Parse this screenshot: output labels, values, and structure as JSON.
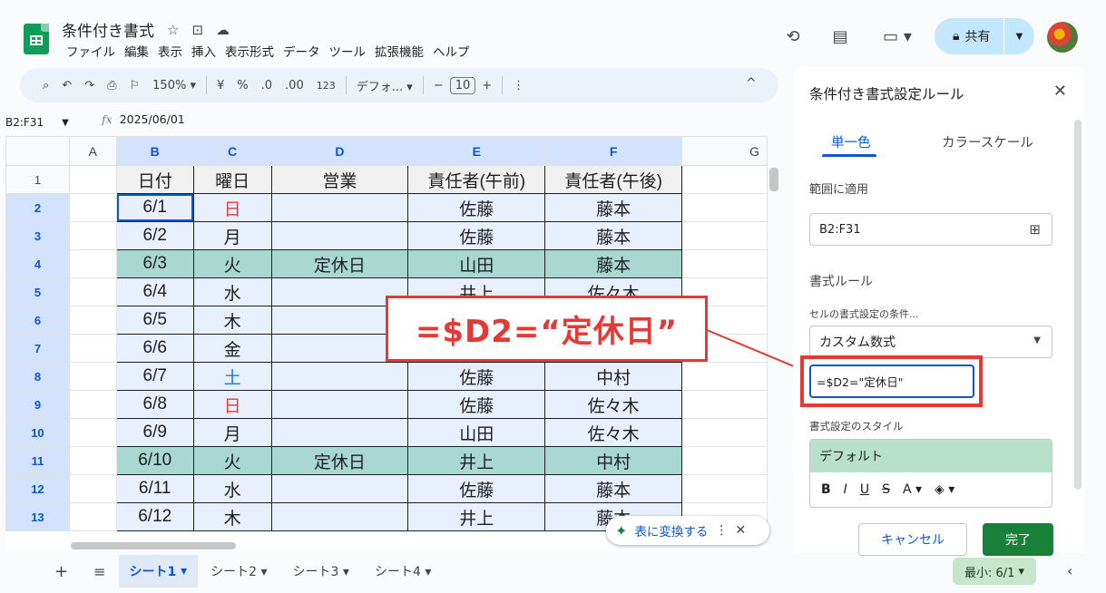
{
  "doc": {
    "title": "条件付き書式",
    "title_icons": [
      "☆",
      "⊡",
      "☁"
    ]
  },
  "menu": [
    "ファイル",
    "編集",
    "表示",
    "挿入",
    "表示形式",
    "データ",
    "ツール",
    "拡張機能",
    "ヘルプ"
  ],
  "header": {
    "share_label": "共有"
  },
  "toolbar": {
    "zoom": "150%",
    "currency": "¥",
    "percent": "%",
    "dec_dec": ".0",
    "dec_inc": ".00",
    "num": "123",
    "font": "デフォ...",
    "minus": "−",
    "font_size": "10",
    "plus": "+",
    "more": "⋮"
  },
  "namebox": "B2:F31",
  "formula": "2025/06/01",
  "columns": [
    "A",
    "B",
    "C",
    "D",
    "E",
    "F",
    "G"
  ],
  "header_row": [
    "日付",
    "曜日",
    "営業",
    "責任者(午前)",
    "責任者(午後)"
  ],
  "rows": [
    {
      "n": "2",
      "date": "6/1",
      "day": "日",
      "business": "",
      "am": "佐藤",
      "pm": "藤本"
    },
    {
      "n": "3",
      "date": "6/2",
      "day": "月",
      "business": "",
      "am": "佐藤",
      "pm": "藤本"
    },
    {
      "n": "4",
      "date": "6/3",
      "day": "火",
      "business": "定休日",
      "am": "山田",
      "pm": "藤本"
    },
    {
      "n": "5",
      "date": "6/4",
      "day": "水",
      "business": "",
      "am": "井上",
      "pm": "佐々木"
    },
    {
      "n": "6",
      "date": "6/5",
      "day": "木",
      "business": "",
      "am": "",
      "pm": ""
    },
    {
      "n": "7",
      "date": "6/6",
      "day": "金",
      "business": "",
      "am": "",
      "pm": ""
    },
    {
      "n": "8",
      "date": "6/7",
      "day": "土",
      "business": "",
      "am": "佐藤",
      "pm": "中村"
    },
    {
      "n": "9",
      "date": "6/8",
      "day": "日",
      "business": "",
      "am": "佐藤",
      "pm": "佐々木"
    },
    {
      "n": "10",
      "date": "6/9",
      "day": "月",
      "business": "",
      "am": "山田",
      "pm": "佐々木"
    },
    {
      "n": "11",
      "date": "6/10",
      "day": "火",
      "business": "定休日",
      "am": "井上",
      "pm": "中村"
    },
    {
      "n": "12",
      "date": "6/11",
      "day": "水",
      "business": "",
      "am": "佐藤",
      "pm": "藤本"
    },
    {
      "n": "13",
      "date": "6/12",
      "day": "木",
      "business": "",
      "am": "井上",
      "pm": "藤本"
    }
  ],
  "row1_label": "1",
  "convert_chip": {
    "label": "表に変換する"
  },
  "callout": "=$D2=“定休日”",
  "panel": {
    "title": "条件付き書式設定ルール",
    "tab_single": "単一色",
    "tab_scale": "カラースケール",
    "range_label": "範囲に適用",
    "range_value": "B2:F31",
    "rules_label": "書式ルール",
    "condition_label": "セルの書式設定の条件...",
    "condition_value": "カスタム数式",
    "formula_value": "=$D2=\"定休日\"",
    "style_label": "書式設定のスタイル",
    "style_preview": "デフォルト",
    "cancel": "キャンセル",
    "done": "完了"
  },
  "sheets": [
    "シート1",
    "シート2",
    "シート3",
    "シート4"
  ],
  "summary": "最小: 6/1",
  "colors": {
    "accent": "#0b57d0",
    "red": "#e53935",
    "green": "#188038",
    "teal_highlight": "#a9d8d1"
  }
}
